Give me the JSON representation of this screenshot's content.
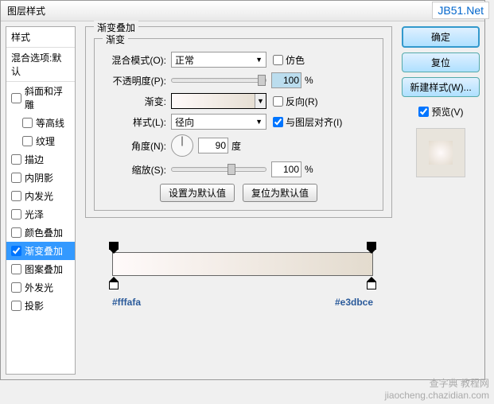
{
  "window": {
    "title": "图层样式"
  },
  "sidebar": {
    "header": "样式",
    "sub": "混合选项:默认",
    "items": [
      {
        "label": "斜面和浮雕",
        "checked": false
      },
      {
        "label": "等高线",
        "checked": false,
        "indent": true
      },
      {
        "label": "纹理",
        "checked": false,
        "indent": true
      },
      {
        "label": "描边",
        "checked": false
      },
      {
        "label": "内阴影",
        "checked": false
      },
      {
        "label": "内发光",
        "checked": false
      },
      {
        "label": "光泽",
        "checked": false
      },
      {
        "label": "颜色叠加",
        "checked": false
      },
      {
        "label": "渐变叠加",
        "checked": true,
        "selected": true
      },
      {
        "label": "图案叠加",
        "checked": false
      },
      {
        "label": "外发光",
        "checked": false
      },
      {
        "label": "投影",
        "checked": false
      }
    ]
  },
  "panel": {
    "title": "渐变叠加",
    "section": "渐变",
    "blend_label": "混合模式(O):",
    "blend_value": "正常",
    "dither_label": "仿色",
    "opacity_label": "不透明度(P):",
    "opacity_value": "100",
    "pct": "%",
    "gradient_label": "渐变:",
    "reverse_label": "反向(R)",
    "style_label": "样式(L):",
    "style_value": "径向",
    "align_label": "与图层对齐(I)",
    "angle_label": "角度(N):",
    "angle_value": "90",
    "angle_unit": "度",
    "scale_label": "缩放(S):",
    "scale_value": "100",
    "default_btn": "设置为默认值",
    "reset_btn": "复位为默认值"
  },
  "buttons": {
    "ok": "确定",
    "cancel": "复位",
    "new_style": "新建样式(W)...",
    "preview": "预览(V)"
  },
  "hex": {
    "left": "#fffafa",
    "right": "#e3dbce"
  },
  "watermark": {
    "top": "JB51.Net",
    "bot1": "查字典 教程网",
    "bot2": "jiaocheng.chazidian.com"
  }
}
